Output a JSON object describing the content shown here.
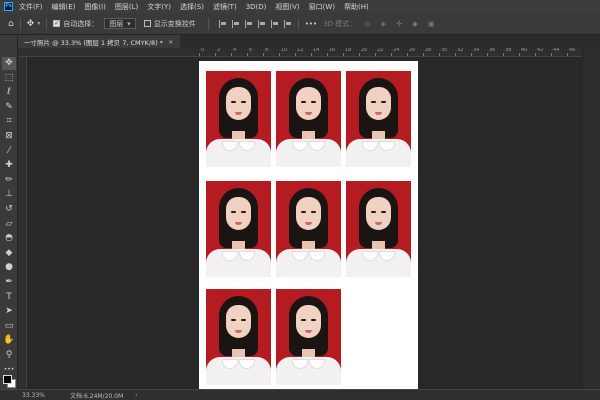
{
  "app": {
    "logo": "Ps"
  },
  "menu": [
    "文件(F)",
    "编辑(E)",
    "图像(I)",
    "图层(L)",
    "文字(Y)",
    "选择(S)",
    "滤镜(T)",
    "3D(D)",
    "视图(V)",
    "窗口(W)",
    "帮助(H)"
  ],
  "options": {
    "auto_select_label": "自动选择：",
    "auto_select_checked": true,
    "layer_select_value": "图层",
    "show_transform_label": "显示变换控件",
    "show_transform_checked": false,
    "more_label": "•••",
    "mode_3d_label": "3D 模式："
  },
  "tab": {
    "title": "一寸照片 @ 33.3% (图层 1 拷贝 7, CMYK/8) *",
    "close": "×"
  },
  "ruler": {
    "labels": [
      "0",
      "2",
      "4",
      "6",
      "8",
      "10",
      "12",
      "14",
      "16",
      "18",
      "20",
      "22",
      "24",
      "26",
      "28",
      "30",
      "32",
      "34",
      "36",
      "38",
      "40",
      "42",
      "44",
      "46",
      "48",
      "50",
      "52",
      "54",
      "56",
      "58",
      "60",
      "62",
      "64",
      "66"
    ]
  },
  "tools": [
    {
      "name": "move-tool",
      "glyph": "✥"
    },
    {
      "name": "marquee-tool",
      "glyph": "⬚"
    },
    {
      "name": "lasso-tool",
      "glyph": "ℓ"
    },
    {
      "name": "quick-select-tool",
      "glyph": "✎"
    },
    {
      "name": "crop-tool",
      "glyph": "⌗"
    },
    {
      "name": "frame-tool",
      "glyph": "⊠"
    },
    {
      "name": "eyedropper-tool",
      "glyph": "⁄"
    },
    {
      "name": "healing-tool",
      "glyph": "✚"
    },
    {
      "name": "brush-tool",
      "glyph": "✏"
    },
    {
      "name": "stamp-tool",
      "glyph": "⊥"
    },
    {
      "name": "history-brush-tool",
      "glyph": "↺"
    },
    {
      "name": "eraser-tool",
      "glyph": "▱"
    },
    {
      "name": "paint-bucket-tool",
      "glyph": "◓"
    },
    {
      "name": "blur-tool",
      "glyph": "◆"
    },
    {
      "name": "dodge-tool",
      "glyph": "●"
    },
    {
      "name": "pen-tool",
      "glyph": "✒"
    },
    {
      "name": "type-tool",
      "glyph": "T"
    },
    {
      "name": "path-select-tool",
      "glyph": "➤"
    },
    {
      "name": "shape-tool",
      "glyph": "▭"
    },
    {
      "name": "hand-tool",
      "glyph": "✋"
    },
    {
      "name": "zoom-tool",
      "glyph": "⚲"
    },
    {
      "name": "more-tools",
      "glyph": "•••"
    }
  ],
  "photos": {
    "background_color": "#b51c22",
    "count": 8
  },
  "status": {
    "zoom": "33.33%",
    "doc_size": "文档:6.24M/20.0M",
    "arrow": "›"
  }
}
